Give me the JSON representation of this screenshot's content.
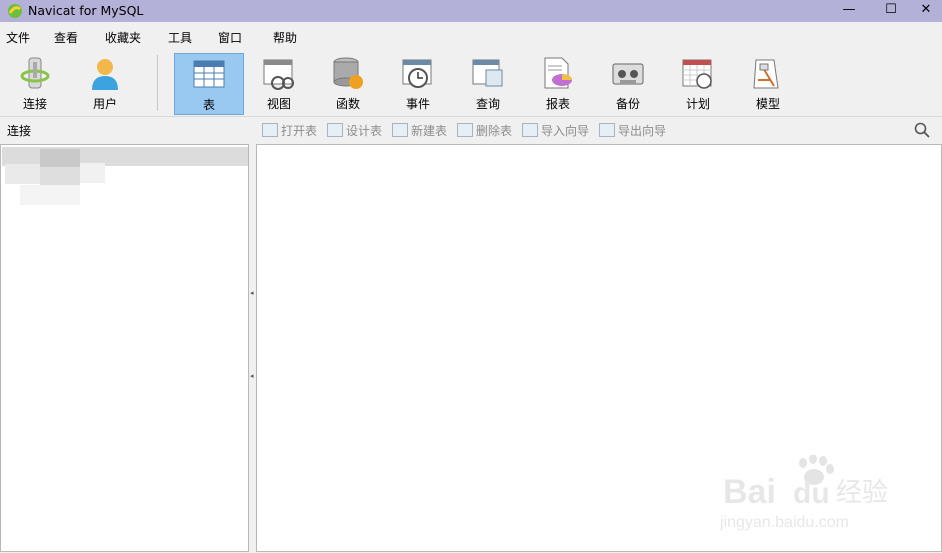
{
  "window": {
    "title": "Navicat for MySQL",
    "minimize": "—",
    "maximize": "☐",
    "close": "✕"
  },
  "menu": [
    "文件",
    "查看",
    "收藏夹",
    "工具",
    "窗口",
    "帮助"
  ],
  "toolbar": {
    "connect": "连接",
    "user": "用户",
    "table": "表",
    "view": "视图",
    "function": "函数",
    "event": "事件",
    "query": "查询",
    "report": "报表",
    "backup": "备份",
    "schedule": "计划",
    "model": "模型",
    "active": "表"
  },
  "sidebar": {
    "title": "连接"
  },
  "actions": {
    "open_table": "打开表",
    "design_table": "设计表",
    "new_table": "新建表",
    "delete_table": "删除表",
    "import_wizard": "导入向导",
    "export_wizard": "导出向导"
  },
  "watermark": {
    "brand": "Bai",
    "brand2": "du",
    "product": "经验",
    "url": "jingyan.baidu.com"
  },
  "colors": {
    "titlebar": "#b3b1d8",
    "active_button": "#99c8f0"
  }
}
